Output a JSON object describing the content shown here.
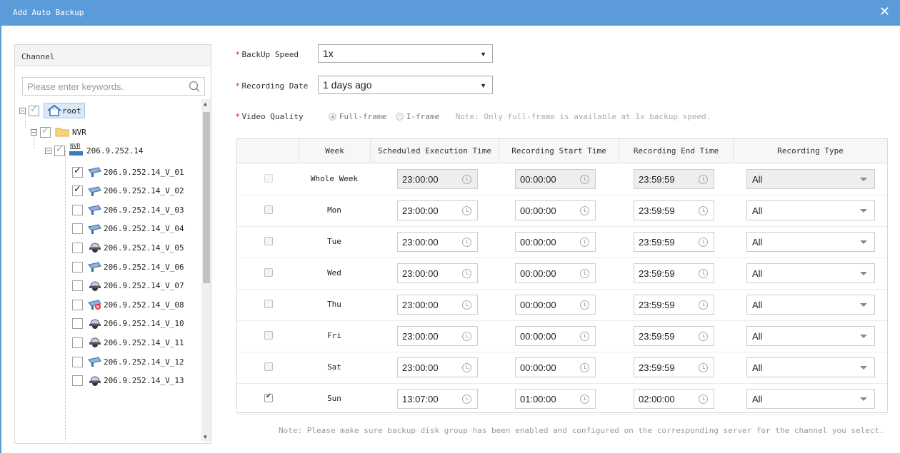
{
  "window": {
    "title": "Add Auto Backup",
    "close_glyph": "✕"
  },
  "channel_panel": {
    "header": "Channel",
    "search_placeholder": "Please enter keywords.",
    "root": {
      "label": "root",
      "checked": true
    },
    "nvr": {
      "label": "NVR",
      "checked": true
    },
    "device": {
      "label": "206.9.252.14",
      "badge": "NVR",
      "checked": true
    },
    "channels": [
      {
        "label": "206.9.252.14_V_01",
        "checked": true,
        "icon": "bullet-camera-icon"
      },
      {
        "label": "206.9.252.14_V_02",
        "checked": true,
        "icon": "bullet-camera-icon"
      },
      {
        "label": "206.9.252.14_V_03",
        "checked": false,
        "icon": "bullet-camera-icon"
      },
      {
        "label": "206.9.252.14_V_04",
        "checked": false,
        "icon": "bullet-camera-icon"
      },
      {
        "label": "206.9.252.14_V_05",
        "checked": false,
        "icon": "dome-camera-icon"
      },
      {
        "label": "206.9.252.14_V_06",
        "checked": false,
        "icon": "bullet-camera-icon"
      },
      {
        "label": "206.9.252.14_V_07",
        "checked": false,
        "icon": "dome-camera-icon"
      },
      {
        "label": "206.9.252.14_V_08",
        "checked": false,
        "icon": "offline-camera-icon"
      },
      {
        "label": "206.9.252.14_V_10",
        "checked": false,
        "icon": "dome-camera-icon"
      },
      {
        "label": "206.9.252.14_V_11",
        "checked": false,
        "icon": "dome-camera-icon"
      },
      {
        "label": "206.9.252.14_V_12",
        "checked": false,
        "icon": "bullet-camera-icon"
      },
      {
        "label": "206.9.252.14_V_13",
        "checked": false,
        "icon": "dome-camera-icon"
      }
    ]
  },
  "form": {
    "backup_speed": {
      "label": "BackUp Speed",
      "value": "1x"
    },
    "recording_date": {
      "label": "Recording Date",
      "value": "1 days ago"
    },
    "video_quality": {
      "label": "Video Quality",
      "options": [
        "Full-frame",
        "I-frame"
      ],
      "selected": "Full-frame",
      "note": "Note: Only full-frame is available at 1x backup speed."
    }
  },
  "schedule_table": {
    "columns": [
      "Week",
      "Scheduled Execution Time",
      "Recording Start Time",
      "Recording End Time",
      "Recording Type"
    ],
    "rows": [
      {
        "week": "Whole Week",
        "checked": false,
        "disabled": true,
        "exec": "23:00:00",
        "start": "00:00:00",
        "end": "23:59:59",
        "type": "All"
      },
      {
        "week": "Mon",
        "checked": false,
        "disabled": false,
        "exec": "23:00:00",
        "start": "00:00:00",
        "end": "23:59:59",
        "type": "All"
      },
      {
        "week": "Tue",
        "checked": false,
        "disabled": false,
        "exec": "23:00:00",
        "start": "00:00:00",
        "end": "23:59:59",
        "type": "All"
      },
      {
        "week": "Wed",
        "checked": false,
        "disabled": false,
        "exec": "23:00:00",
        "start": "00:00:00",
        "end": "23:59:59",
        "type": "All"
      },
      {
        "week": "Thu",
        "checked": false,
        "disabled": false,
        "exec": "23:00:00",
        "start": "00:00:00",
        "end": "23:59:59",
        "type": "All"
      },
      {
        "week": "Fri",
        "checked": false,
        "disabled": false,
        "exec": "23:00:00",
        "start": "00:00:00",
        "end": "23:59:59",
        "type": "All"
      },
      {
        "week": "Sat",
        "checked": false,
        "disabled": false,
        "exec": "23:00:00",
        "start": "00:00:00",
        "end": "23:59:59",
        "type": "All"
      },
      {
        "week": "Sun",
        "checked": true,
        "disabled": false,
        "exec": "13:07:00",
        "start": "01:00:00",
        "end": "02:00:00",
        "type": "All"
      }
    ]
  },
  "footer_note": "Note: Please make sure backup disk group has been enabled and configured on the corresponding server for the channel you select.",
  "colors": {
    "titlebar": "#5b9bd9",
    "required": "#e02020"
  }
}
